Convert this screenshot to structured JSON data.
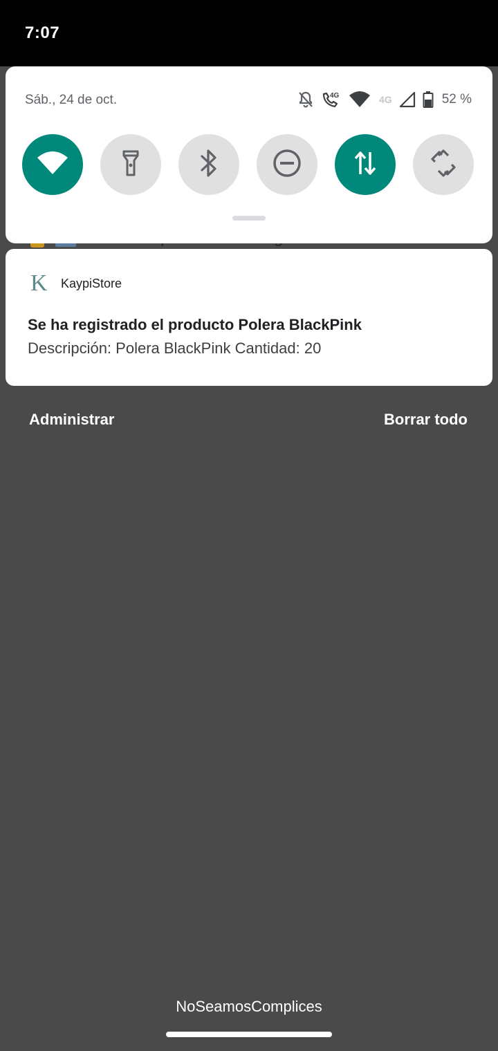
{
  "status_bar": {
    "time": "7:07"
  },
  "quick_settings": {
    "date": "Sáb., 24 de oct.",
    "battery_percent": "52 %",
    "signal_label": "4G",
    "call_label": "4G",
    "accent_color": "#00897b",
    "tiles": [
      {
        "icon": "wifi-icon",
        "state": "on"
      },
      {
        "icon": "flashlight-icon",
        "state": "off"
      },
      {
        "icon": "bluetooth-icon",
        "state": "off"
      },
      {
        "icon": "do-not-disturb-icon",
        "state": "off"
      },
      {
        "icon": "mobile-data-icon",
        "state": "on"
      },
      {
        "icon": "auto-rotate-icon",
        "state": "off"
      }
    ]
  },
  "background_notification": {
    "text": "Dictado por voz de Google"
  },
  "notification": {
    "app_name": "KaypiStore",
    "app_icon_letter": "K",
    "title": "Se ha registrado el producto Polera BlackPink",
    "text": "Descripción: Polera BlackPink Cantidad: 20"
  },
  "actions": {
    "manage": "Administrar",
    "clear_all": "Borrar todo"
  },
  "carrier": "NoSeamosComplices"
}
